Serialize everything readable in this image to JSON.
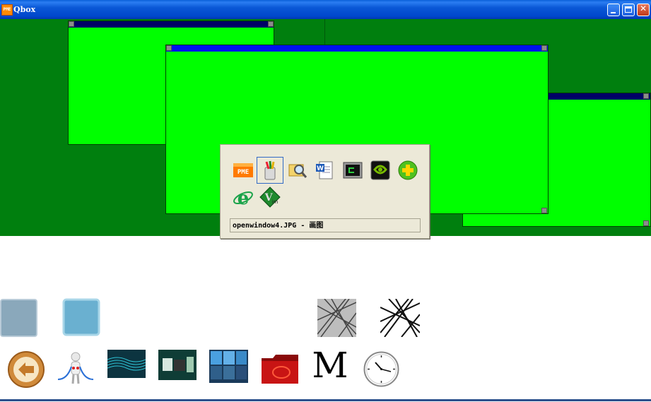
{
  "window": {
    "title": "Qbox",
    "app_icon_label": "PME"
  },
  "titlebar_buttons": [
    "minimize",
    "maximize",
    "close"
  ],
  "switcher": {
    "icons": [
      {
        "name": "pme-icon",
        "label": "PME"
      },
      {
        "name": "paint-icon",
        "label": "",
        "selected": true
      },
      {
        "name": "search-files-icon",
        "label": ""
      },
      {
        "name": "word-document-icon",
        "label": ""
      },
      {
        "name": "terminal-icon",
        "label": ""
      },
      {
        "name": "nvidia-icon",
        "label": ""
      },
      {
        "name": "360-safe-icon",
        "label": ""
      },
      {
        "name": "internet-explorer-icon",
        "label": ""
      },
      {
        "name": "vim-icon",
        "label": ""
      }
    ],
    "status_text": "openwindow4.JPG - 画图"
  },
  "dock": {
    "row1": [
      "square-blue-grey-icon",
      "square-light-blue-icon",
      "grey-lines-icon",
      "black-lines-icon"
    ],
    "row2": [
      "back-arrow-icon",
      "person-figure-icon",
      "blue-wave-thumbnail-icon",
      "green-scene-thumbnail-icon",
      "grid-images-thumbnail-icon",
      "red-folder-icon",
      "m-logo-icon",
      "clock-icon"
    ],
    "m_letter": "M"
  },
  "colors": {
    "desktop": "#007f0e",
    "window_fill": "#00ff00",
    "active_bar": "#0011ee",
    "inactive_bar": "#000066",
    "switcher_bg": "#ece9d8"
  }
}
